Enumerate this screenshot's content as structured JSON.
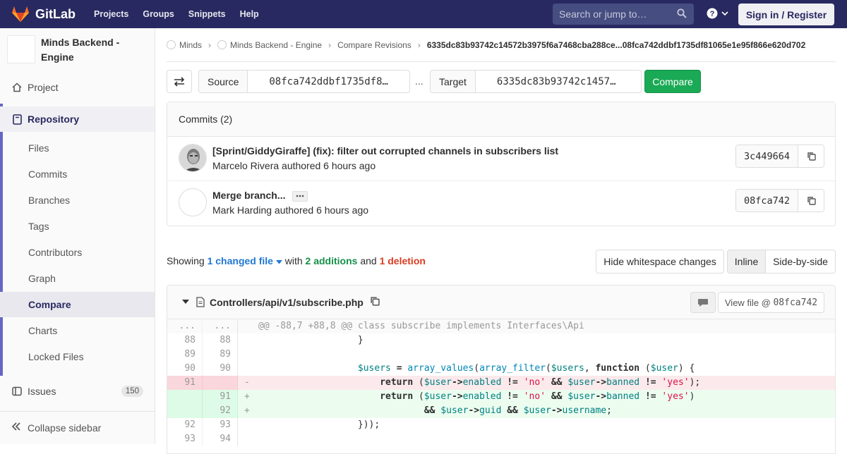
{
  "navbar": {
    "brand": "GitLab",
    "links": [
      "Projects",
      "Groups",
      "Snippets",
      "Help"
    ],
    "search_placeholder": "Search or jump to…",
    "signin_label": "Sign in / Register"
  },
  "sidebar": {
    "project_name": "Minds Backend - Engine",
    "project_label": "Project",
    "repository_label": "Repository",
    "sub_items": [
      "Files",
      "Commits",
      "Branches",
      "Tags",
      "Contributors",
      "Graph",
      "Compare",
      "Charts",
      "Locked Files"
    ],
    "active_item": "Compare",
    "issues_label": "Issues",
    "issues_count": "150",
    "collapse_label": "Collapse sidebar"
  },
  "breadcrumb": {
    "items": [
      "Minds",
      "Minds Backend - Engine",
      "Compare Revisions"
    ],
    "current": "6335dc83b93742c14572b3975f6a7468cba288ce...08fca742ddbf1735df81065e1e95f866e620d702"
  },
  "compare_form": {
    "source_label": "Source",
    "source_value": "08fca742ddbf1735df8…",
    "separator": "...",
    "target_label": "Target",
    "target_value": "6335dc83b93742c1457…",
    "compare_label": "Compare"
  },
  "commits": {
    "header": "Commits (2)",
    "items": [
      {
        "title": "[Sprint/GiddyGiraffe] (fix): filter out corrupted channels in subscribers list",
        "author_line": "Marcelo Rivera authored 6 hours ago",
        "sha": "3c449664"
      },
      {
        "title": "Merge branch...",
        "author_line": "Mark Harding authored 6 hours ago",
        "sha": "08fca742"
      }
    ]
  },
  "summary": {
    "showing": "Showing",
    "changed": "1 changed file",
    "with": "with",
    "additions": "2 additions",
    "and": "and",
    "deletions": "1 deletion",
    "whitespace_btn": "Hide whitespace changes",
    "inline_btn": "Inline",
    "sidebyside_btn": "Side-by-side"
  },
  "file": {
    "path": "Controllers/api/v1/subscribe.php",
    "view_file_prefix": "View file @",
    "view_file_sha": "08fca742"
  },
  "diff_lines": [
    {
      "type": "match",
      "old": "...",
      "new": "...",
      "text": "@@ -88,7 +88,8 @@ class subscribe implements Interfaces\\Api"
    },
    {
      "type": "ctx",
      "old": "88",
      "new": "88",
      "text": "}"
    },
    {
      "type": "ctx",
      "old": "89",
      "new": "89",
      "text": ""
    },
    {
      "type": "ctx",
      "old": "90",
      "new": "90",
      "text": "$users = array_values(array_filter($users, function ($user) {"
    },
    {
      "type": "old",
      "old": "91",
      "new": "",
      "text": "return ($user->enabled != 'no' && $user->banned != 'yes');"
    },
    {
      "type": "new",
      "old": "",
      "new": "91",
      "text": "return ($user->enabled != 'no' && $user->banned != 'yes')"
    },
    {
      "type": "new",
      "old": "",
      "new": "92",
      "text": "&& $user->guid && $user->username;"
    },
    {
      "type": "ctx",
      "old": "92",
      "new": "93",
      "text": "}));"
    },
    {
      "type": "ctx",
      "old": "93",
      "new": "94",
      "text": ""
    }
  ],
  "colors": {
    "navbar": "#292961",
    "compare_button": "#1aaa55",
    "additions": "#168f48",
    "deletions": "#db3b21",
    "link": "#1f78d1"
  }
}
